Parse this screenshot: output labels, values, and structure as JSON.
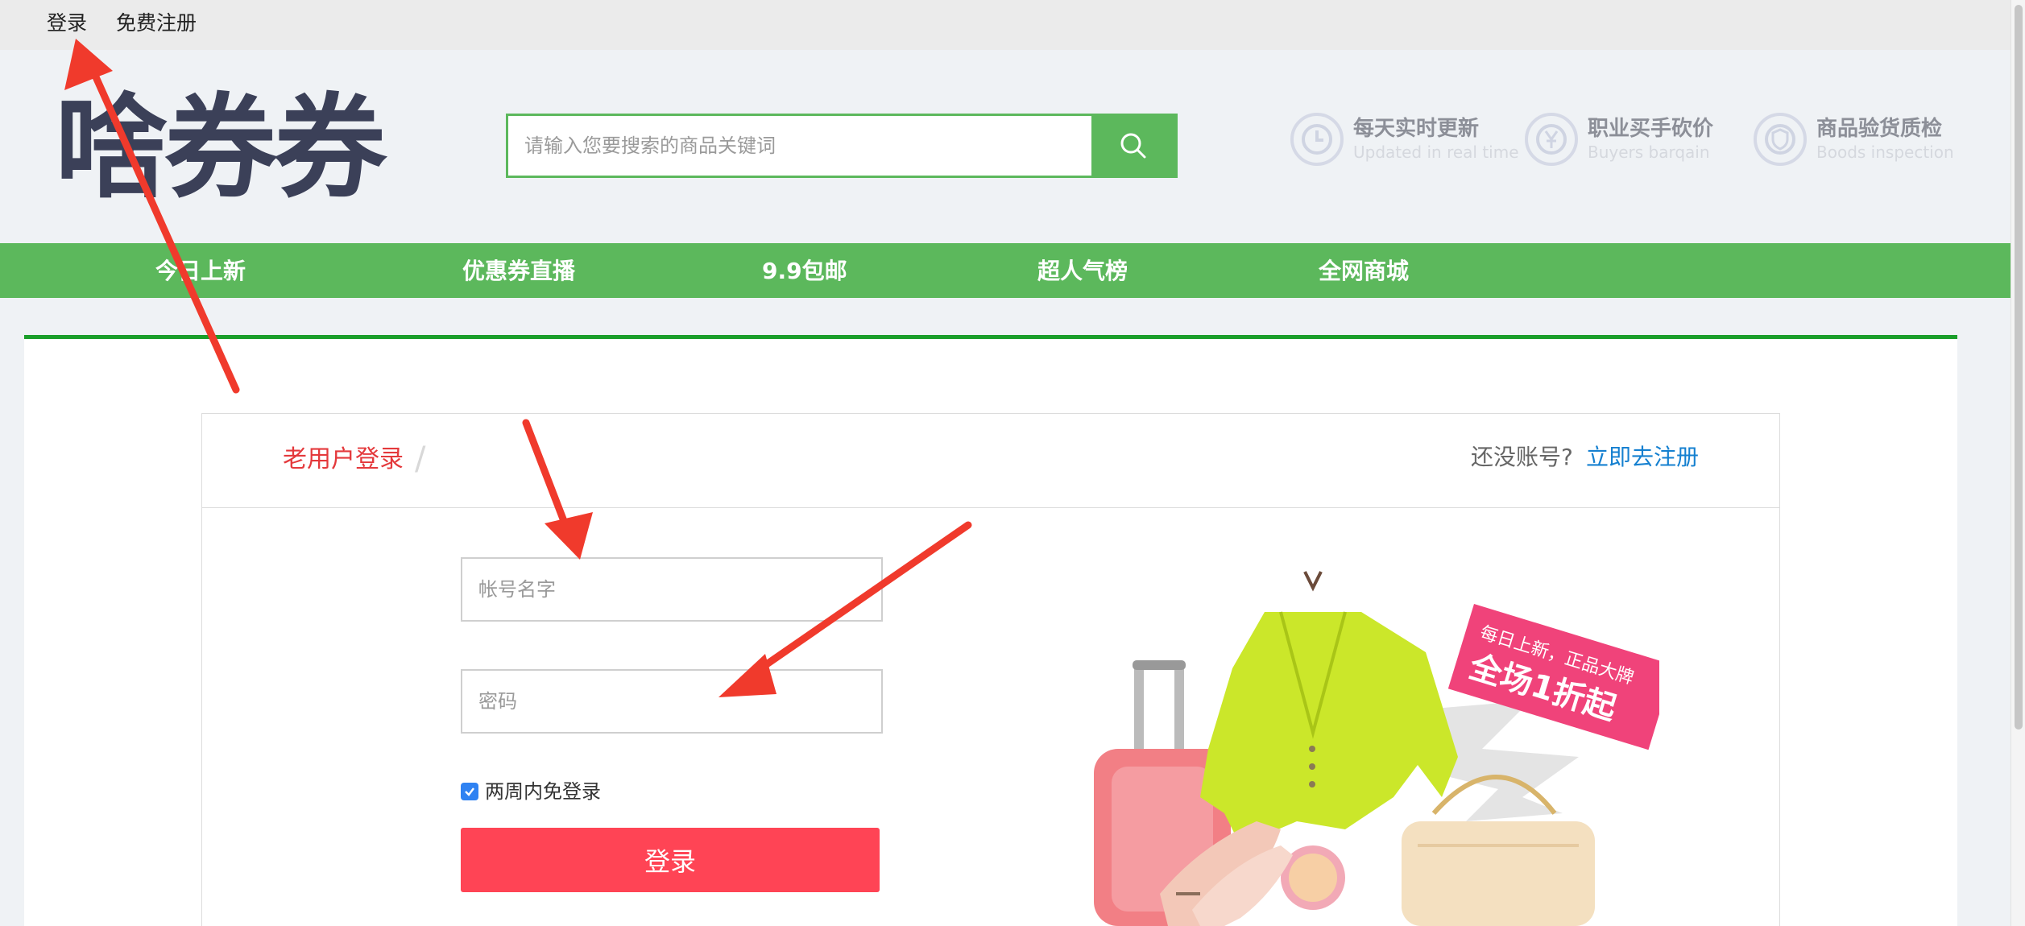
{
  "topbar": {
    "login": "登录",
    "register": "免费注册"
  },
  "header": {
    "logo": "啥券券",
    "search": {
      "placeholder": "请输入您要搜索的商品关键词",
      "value": ""
    },
    "features": [
      {
        "title": "每天实时更新",
        "subtitle": "Updated in real time",
        "icon": "clock-icon"
      },
      {
        "title": "职业买手砍价",
        "subtitle": "Buyers barqain",
        "icon": "yen-icon"
      },
      {
        "title": "商品验货质检",
        "subtitle": "Boods inspection",
        "icon": "shield-icon"
      }
    ]
  },
  "nav": {
    "items": [
      "今日上新",
      "优惠券直播",
      "9.9包邮",
      "超人气榜",
      "全网商城"
    ]
  },
  "login_panel": {
    "title": "老用户登录",
    "no_account": "还没账号?",
    "register_link": "立即去注册",
    "username_placeholder": "帐号名字",
    "password_placeholder": "密码",
    "remember_label": "两周内免登录",
    "remember_checked": true,
    "login_button": "登录"
  },
  "promo": {
    "tag_line1": "每日上新，正品大牌",
    "tag_line2": "全场1折起"
  },
  "colors": {
    "accent_green": "#5cb85c",
    "dark_green": "#1a9e2a",
    "login_red": "#ff4455",
    "link_blue": "#1580d0",
    "arrow_red": "#f03a2c"
  }
}
